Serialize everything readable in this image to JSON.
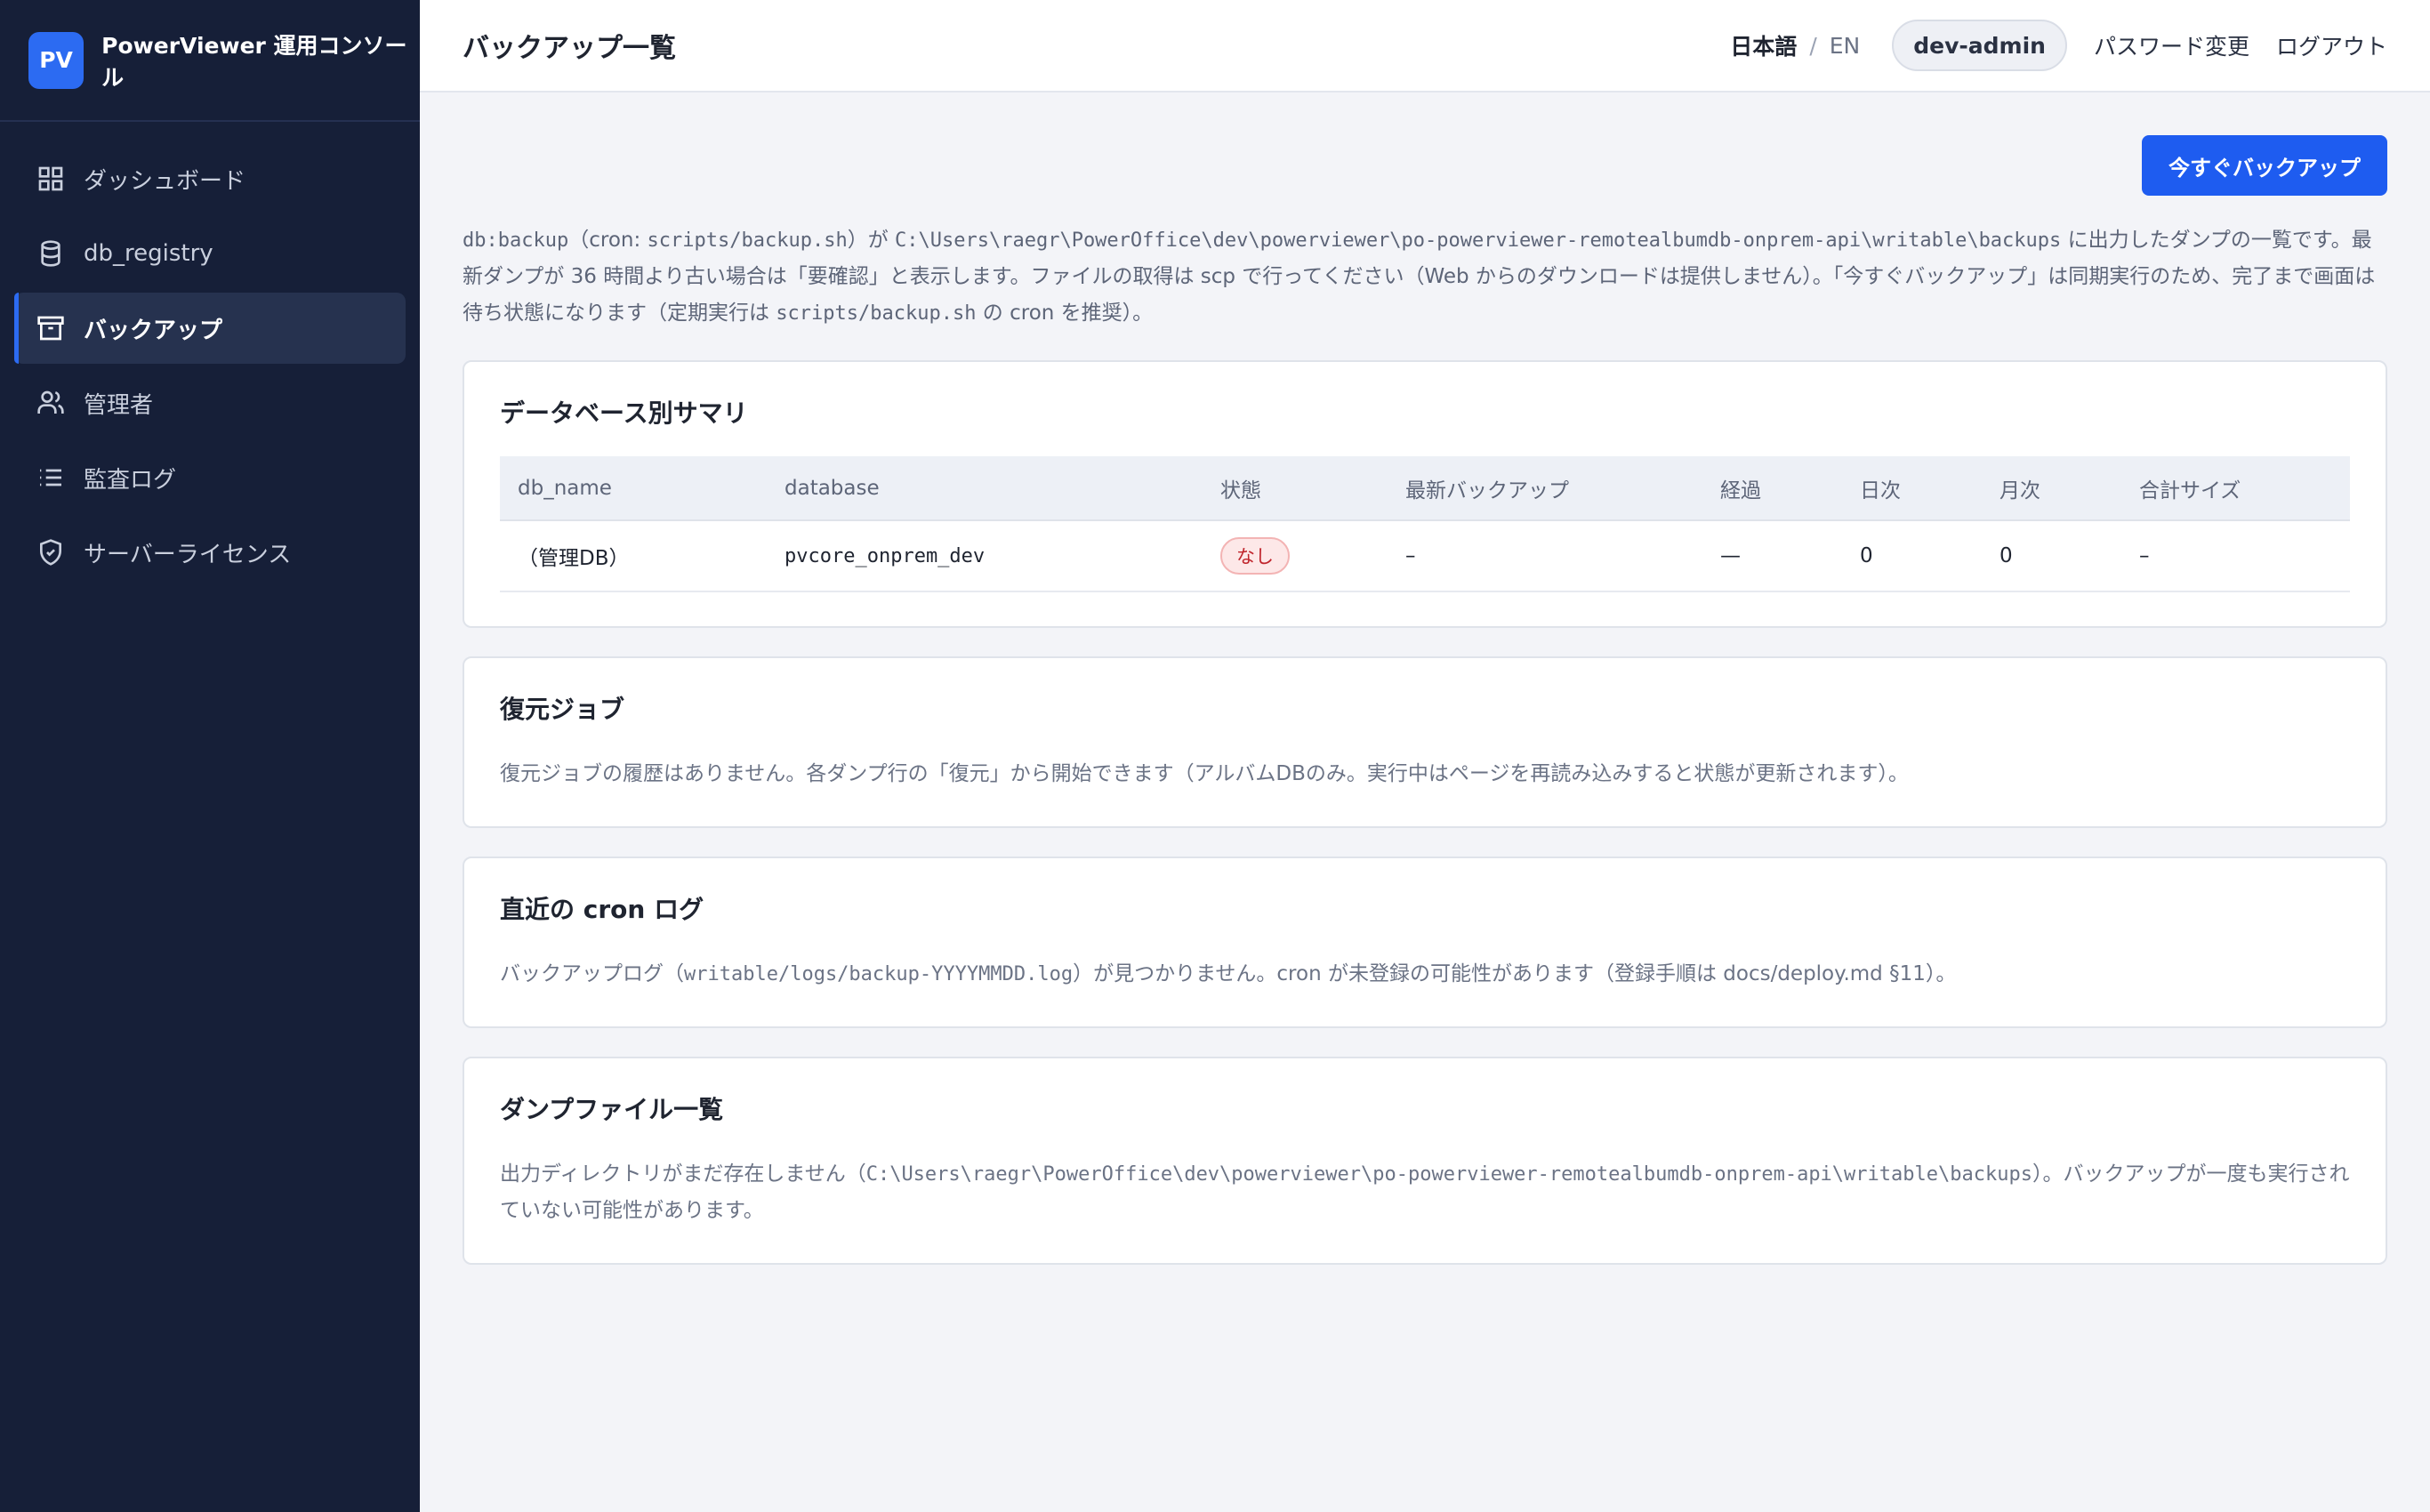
{
  "brand": {
    "logo": "PV",
    "title": "PowerViewer 運用コンソール",
    "accent": "#2c6bf2"
  },
  "sidebar": {
    "items": [
      {
        "label": "ダッシュボード",
        "icon": "grid-icon"
      },
      {
        "label": "db_registry",
        "icon": "database-icon"
      },
      {
        "label": "バックアップ",
        "icon": "archive-icon",
        "active": true
      },
      {
        "label": "管理者",
        "icon": "users-icon"
      },
      {
        "label": "監査ログ",
        "icon": "list-icon"
      },
      {
        "label": "サーバーライセンス",
        "icon": "shield-check-icon"
      }
    ]
  },
  "header": {
    "title": "バックアップ一覧",
    "lang_ja": "日本語",
    "lang_sep": "/",
    "lang_en": "EN",
    "user": "dev-admin",
    "change_password": "パスワード変更",
    "logout": "ログアウト"
  },
  "actions": {
    "backup_now": "今すぐバックアップ"
  },
  "description": {
    "p1": "db:backup",
    "p2": "（cron: ",
    "p3": "scripts/backup.sh",
    "p4": "）が ",
    "p5": "C:\\Users\\raegr\\PowerOffice\\dev\\powerviewer\\po-powerviewer-remotealbumdb-onprem-api\\writable\\backups",
    "p6": " に出力したダンプの一覧です。最新ダンプが 36 時間より古い場合は「要確認」と表示します。ファイルの取得は scp で行ってください（Web からのダウンロードは提供しません）。「今すぐバックアップ」は同期実行のため、完了まで画面は待ち状態になります（定期実行は ",
    "p7": "scripts/backup.sh",
    "p8": " の cron を推奨）。"
  },
  "summary": {
    "title": "データベース別サマリ",
    "columns": [
      "db_name",
      "database",
      "状態",
      "最新バックアップ",
      "経過",
      "日次",
      "月次",
      "合計サイズ"
    ],
    "rows": [
      {
        "db_name": "（管理DB）",
        "database": "pvcore_onprem_dev",
        "status": "なし",
        "latest": "–",
        "elapsed": "—",
        "daily": "0",
        "monthly": "0",
        "total_size": "–"
      }
    ]
  },
  "restore": {
    "title": "復元ジョブ",
    "text": "復元ジョブの履歴はありません。各ダンプ行の「復元」から開始できます（アルバムDBのみ。実行中はページを再読み込みすると状態が更新されます）。"
  },
  "cron": {
    "title": "直近の cron ログ",
    "t1": "バックアップログ（",
    "t2": "writable/logs/backup-YYYYMMDD.log",
    "t3": "）が見つかりません。cron が未登録の可能性があります（登録手順は docs/deploy.md §11）。"
  },
  "dumps": {
    "title": "ダンプファイル一覧",
    "t1": "出力ディレクトリがまだ存在しません（",
    "t2": "C:\\Users\\raegr\\PowerOffice\\dev\\powerviewer\\po-powerviewer-remotealbumdb-onprem-api\\writable\\backups",
    "t3": "）。バックアップが一度も実行されていない可能性があります。"
  }
}
